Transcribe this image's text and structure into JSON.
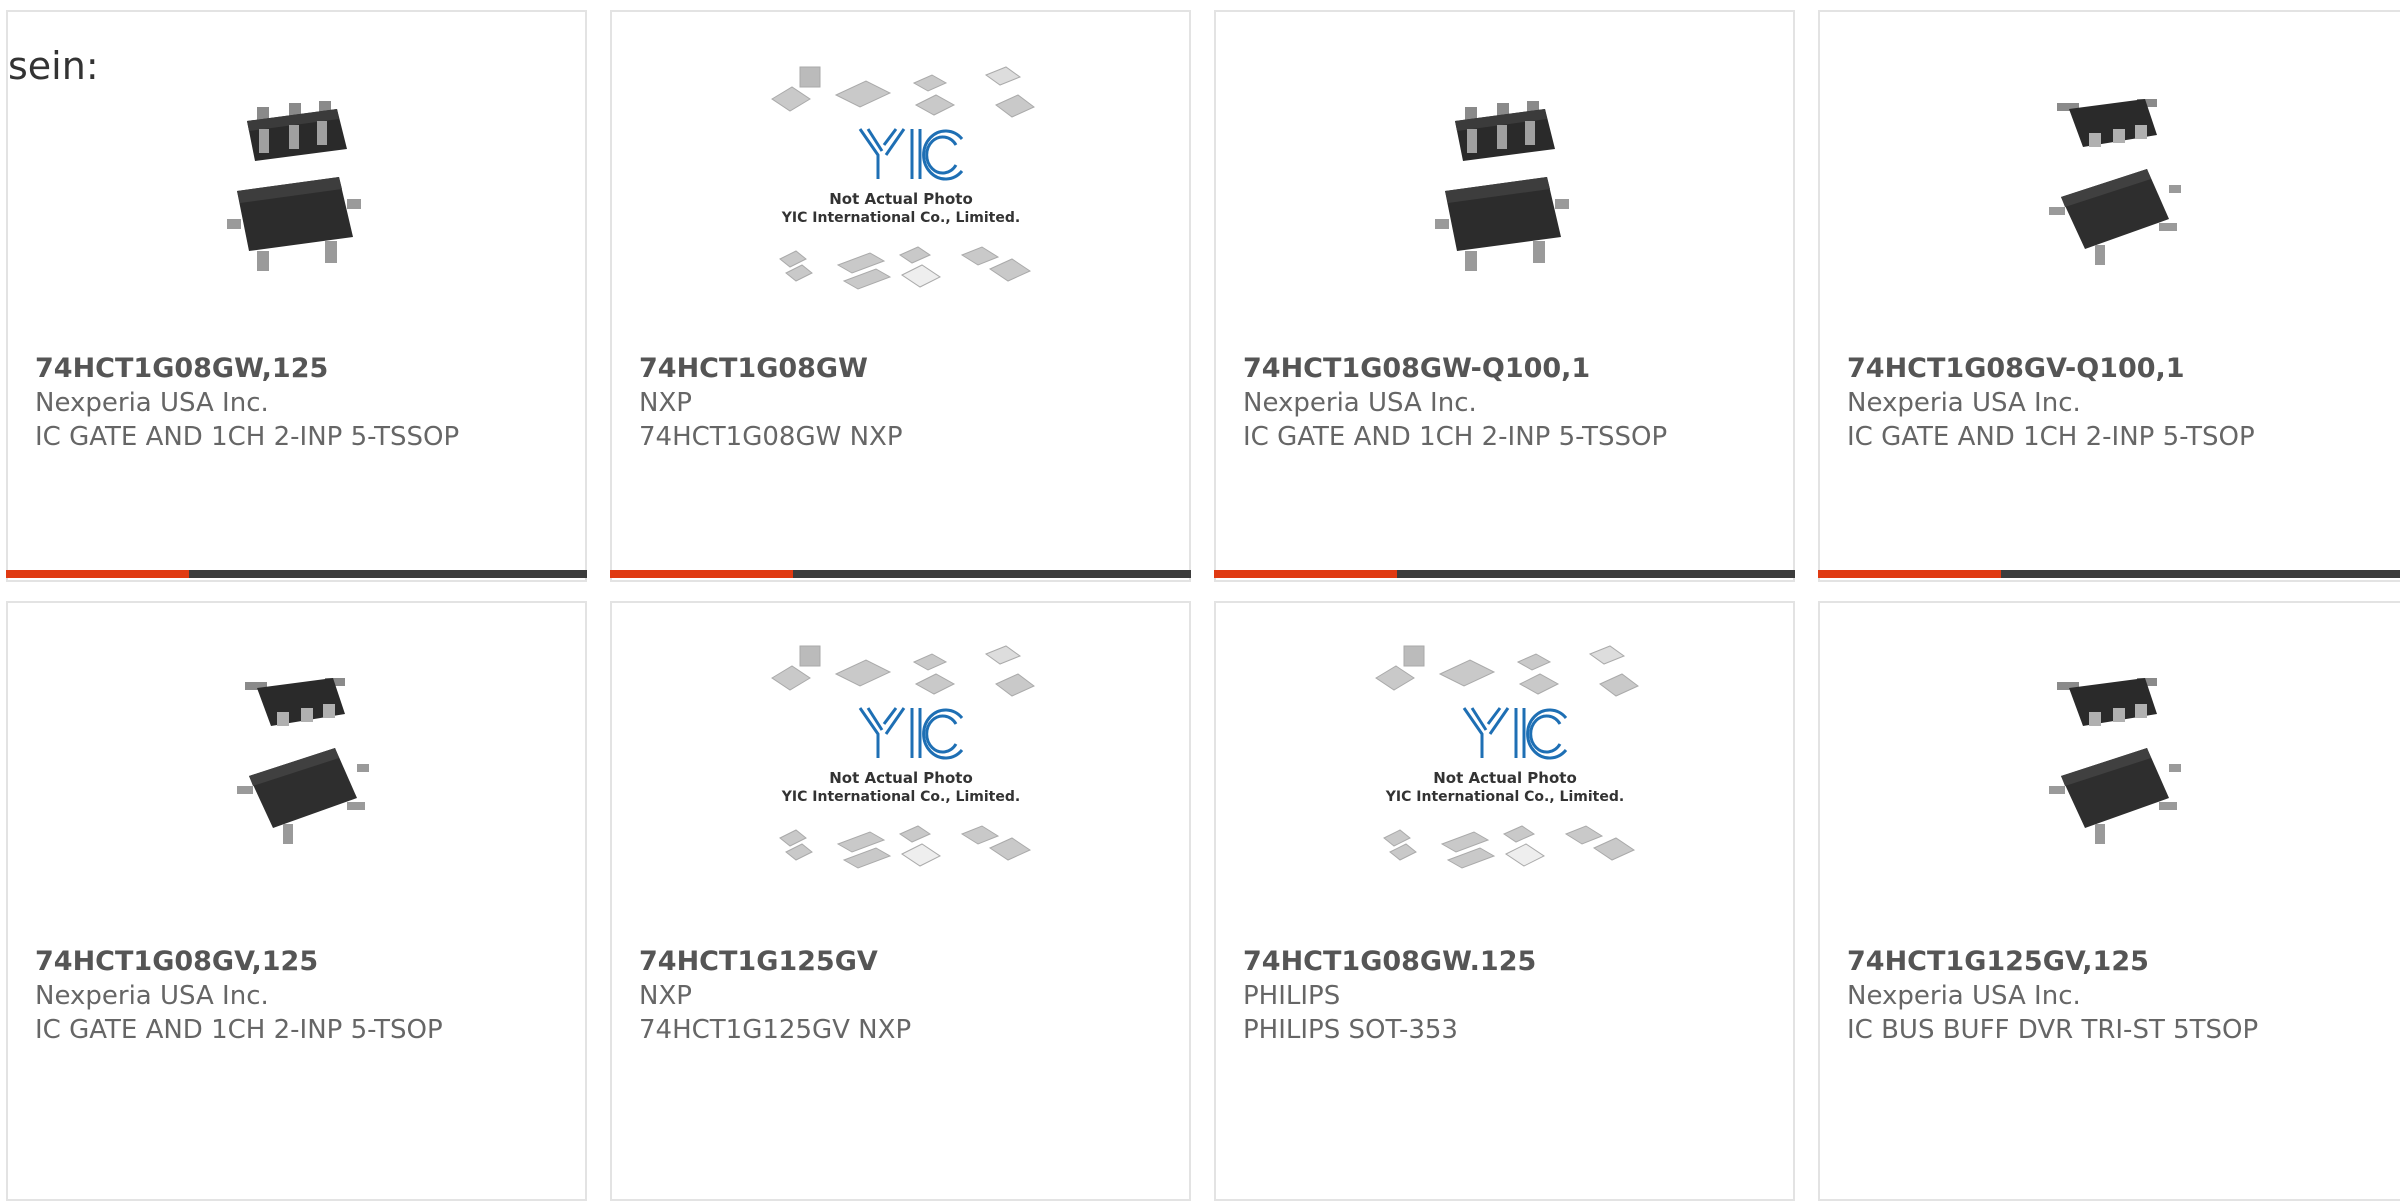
{
  "lead_text": "sein:",
  "placeholder": {
    "logo": "YIC",
    "line1": "Not Actual Photo",
    "line2": "YIC International Co., Limited."
  },
  "colors": {
    "accent": "#e03a12",
    "bar": "#3c3c3c",
    "card_border": "#e3e3e3",
    "logo_blue": "#1e6fb4"
  },
  "products": [
    {
      "part": "74HCT1G08GW,125",
      "maker": "Nexperia USA Inc.",
      "desc": "IC GATE AND 1CH 2-INP 5-TSSOP",
      "image": "sot-package-photo"
    },
    {
      "part": "74HCT1G08GW",
      "maker": "NXP",
      "desc": "74HCT1G08GW NXP",
      "image": "not-actual-photo-placeholder"
    },
    {
      "part": "74HCT1G08GW-Q100,1",
      "maker": "Nexperia USA Inc.",
      "desc": "IC GATE AND 1CH 2-INP 5-TSSOP",
      "image": "sot-package-photo"
    },
    {
      "part": "74HCT1G08GV-Q100,1",
      "maker": "Nexperia USA Inc.",
      "desc": "IC GATE AND 1CH 2-INP 5-TSOP",
      "image": "sot-package-photo-angled"
    },
    {
      "part": "74HCT1G08GV,125",
      "maker": "Nexperia USA Inc.",
      "desc": "IC GATE AND 1CH 2-INP 5-TSOP",
      "image": "sot-package-photo-angled"
    },
    {
      "part": "74HCT1G125GV",
      "maker": "NXP",
      "desc": "74HCT1G125GV NXP",
      "image": "not-actual-photo-placeholder"
    },
    {
      "part": "74HCT1G08GW.125",
      "maker": "PHILIPS",
      "desc": "PHILIPS SOT-353",
      "image": "not-actual-photo-placeholder"
    },
    {
      "part": "74HCT1G125GV,125",
      "maker": "Nexperia USA Inc.",
      "desc": "IC BUS BUFF DVR TRI-ST 5TSOP",
      "image": "sot-package-photo-angled"
    }
  ]
}
